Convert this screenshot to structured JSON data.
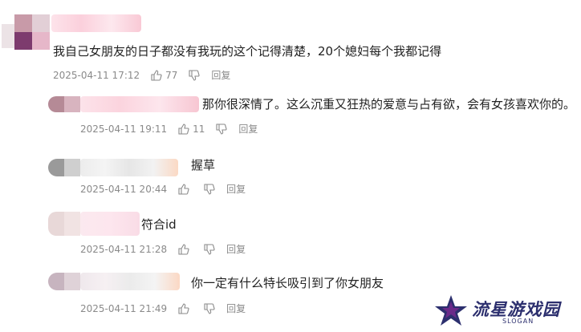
{
  "comments": [
    {
      "text": "我自己女朋友的日子都没有我玩的这个记得清楚，20个媳妇每个我都记得",
      "date": "2025-04-11 17:12",
      "likes": "77",
      "reply_label": "回复"
    },
    {
      "text": "那你很深情了。这么沉重又狂热的爱意与占有欲，会有女孩喜欢你的。",
      "date": "2025-04-11 19:11",
      "likes": "11",
      "reply_label": "回复"
    },
    {
      "text": "握草",
      "date": "2025-04-11 20:44",
      "likes": "",
      "reply_label": "回复"
    },
    {
      "text": "符合id",
      "date": "2025-04-11 21:28",
      "likes": "",
      "reply_label": "回复"
    },
    {
      "text": "你一定有什么特长吸引到了你女朋友",
      "date": "2025-04-11 21:49",
      "likes": "",
      "reply_label": "回复"
    }
  ],
  "watermark": {
    "name": "流星游戏园",
    "slogan": "SLOGAN"
  },
  "colors": {
    "meta_text": "#8a8a8a",
    "logo_navy": "#2c2f6e",
    "logo_purple": "#6a2a8a"
  },
  "icons": [
    "thumb-up-icon",
    "thumb-down-icon",
    "star-logo-icon"
  ]
}
